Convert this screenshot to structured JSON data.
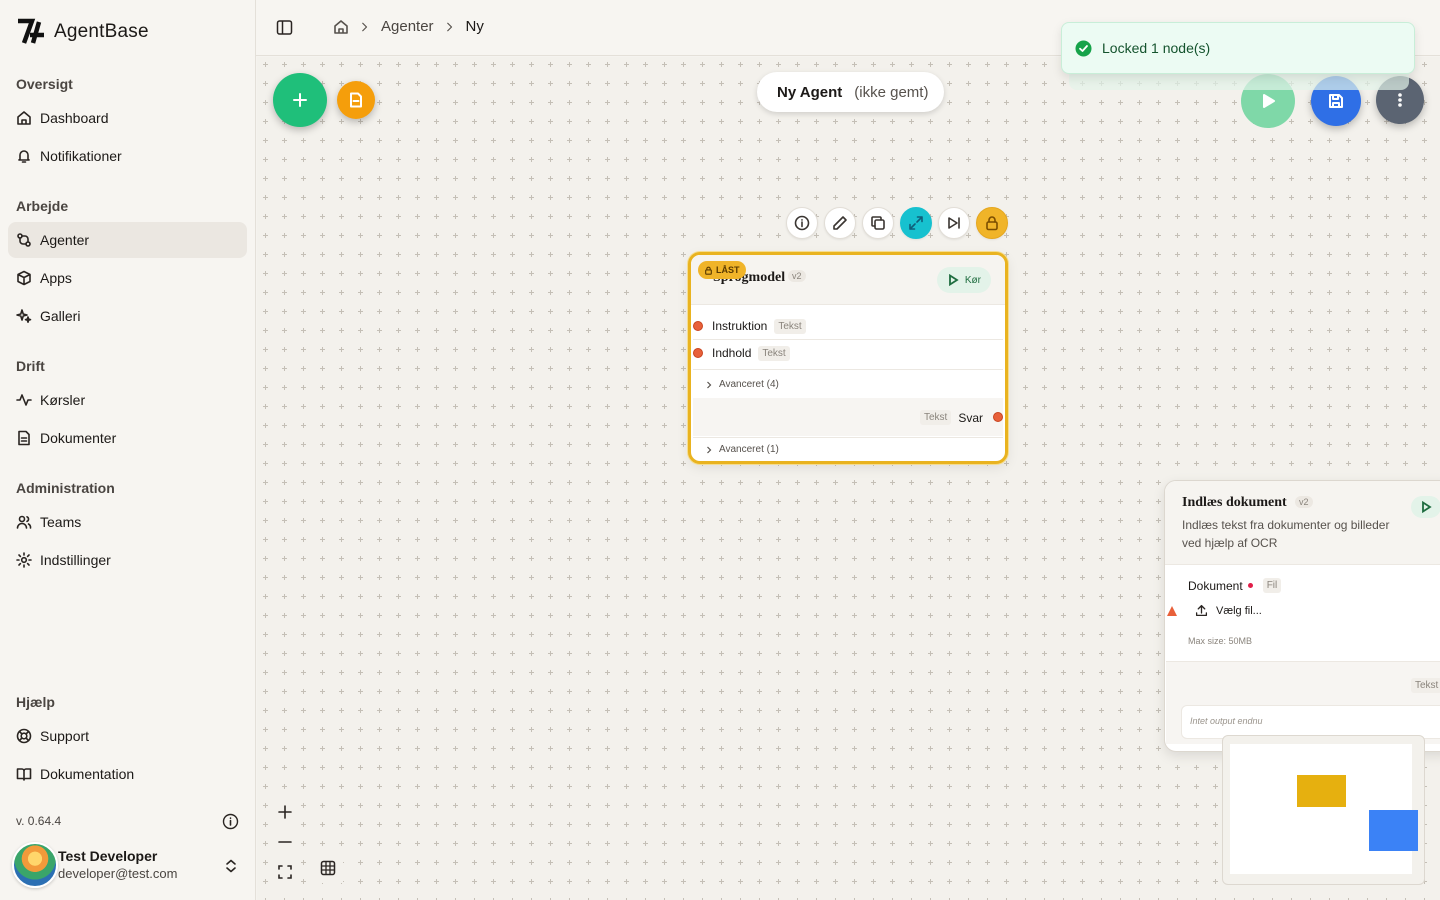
{
  "app": {
    "name": "AgentBase"
  },
  "sidebar": {
    "sections": [
      {
        "title": "Oversigt",
        "items": [
          {
            "label": "Dashboard",
            "icon": "home-icon"
          },
          {
            "label": "Notifikationer",
            "icon": "bell-icon"
          }
        ]
      },
      {
        "title": "Arbejde",
        "items": [
          {
            "label": "Agenter",
            "icon": "workflow-icon",
            "active": true
          },
          {
            "label": "Apps",
            "icon": "box-icon"
          },
          {
            "label": "Galleri",
            "icon": "sparkles-icon"
          }
        ]
      },
      {
        "title": "Drift",
        "items": [
          {
            "label": "Kørsler",
            "icon": "activity-icon"
          },
          {
            "label": "Dokumenter",
            "icon": "document-icon"
          }
        ]
      },
      {
        "title": "Administration",
        "items": [
          {
            "label": "Teams",
            "icon": "users-icon"
          },
          {
            "label": "Indstillinger",
            "icon": "settings-icon"
          }
        ]
      },
      {
        "title": "Hjælp",
        "items": [
          {
            "label": "Support",
            "icon": "lifebuoy-icon"
          },
          {
            "label": "Dokumentation",
            "icon": "book-icon"
          }
        ]
      }
    ],
    "version": "v. 0.64.4",
    "user": {
      "name": "Test Developer",
      "email": "developer@test.com"
    }
  },
  "breadcrumb": {
    "items": [
      "Agenter",
      "Ny"
    ]
  },
  "agent": {
    "name": "Ny Agent",
    "status": "(ikke gemt)"
  },
  "toast": {
    "message": "Locked 1 node(s)"
  },
  "colors": {
    "add": "#1fbf7a",
    "template": "#f59e0b",
    "run": "#7fd8a8",
    "save": "#2f6fe6",
    "more": "#5b6472",
    "lock": "#f0b429",
    "port": "#e8603a"
  },
  "locked_node": {
    "lock_label": "LÅST",
    "title": "Sprogmodel",
    "version": "v2",
    "run_label": "Kør",
    "inputs": [
      {
        "label": "Instruktion",
        "type": "Tekst"
      },
      {
        "label": "Indhold",
        "type": "Tekst"
      }
    ],
    "advanced_in": "Avanceret (4)",
    "output": {
      "label": "Svar",
      "type": "Tekst"
    },
    "advanced_out": "Avanceret (1)"
  },
  "doc_node": {
    "title": "Indlæs dokument",
    "version": "v2",
    "description": "Indlæs tekst fra dokumenter og billeder ved hjælp af OCR",
    "input_label": "Dokument",
    "input_type": "Fil",
    "file_button": "Vælg fil...",
    "max_size": "Max size: 50MB",
    "output_type": "Tekst",
    "output_placeholder": "Intet output endnu"
  }
}
